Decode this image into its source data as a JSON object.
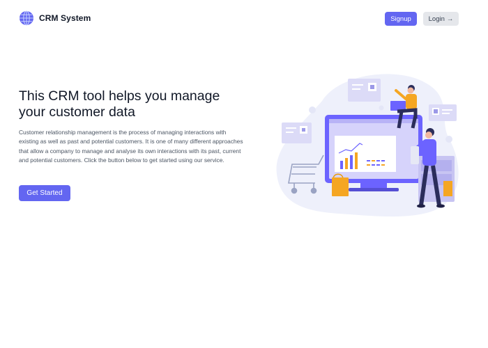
{
  "brand": {
    "name": "CRM System",
    "logo_icon": "globe-icon"
  },
  "nav": {
    "signup_label": "Signup",
    "login_label": "Login",
    "login_icon": "arrow-right-icon"
  },
  "hero": {
    "title": "This CRM tool helps you manage your customer data",
    "description": "Customer relationship management is the process of managing interactions with existing as well as past and potential customers. It is one of many different approaches that allow a company to manage and analyse its own interactions with its past, current and potential customers. Click the button below to get started using our service.",
    "cta_label": "Get Started"
  },
  "colors": {
    "accent": "#6366f1",
    "muted_button": "#e5e7eb",
    "illustration_bg": "#eef0fb"
  }
}
